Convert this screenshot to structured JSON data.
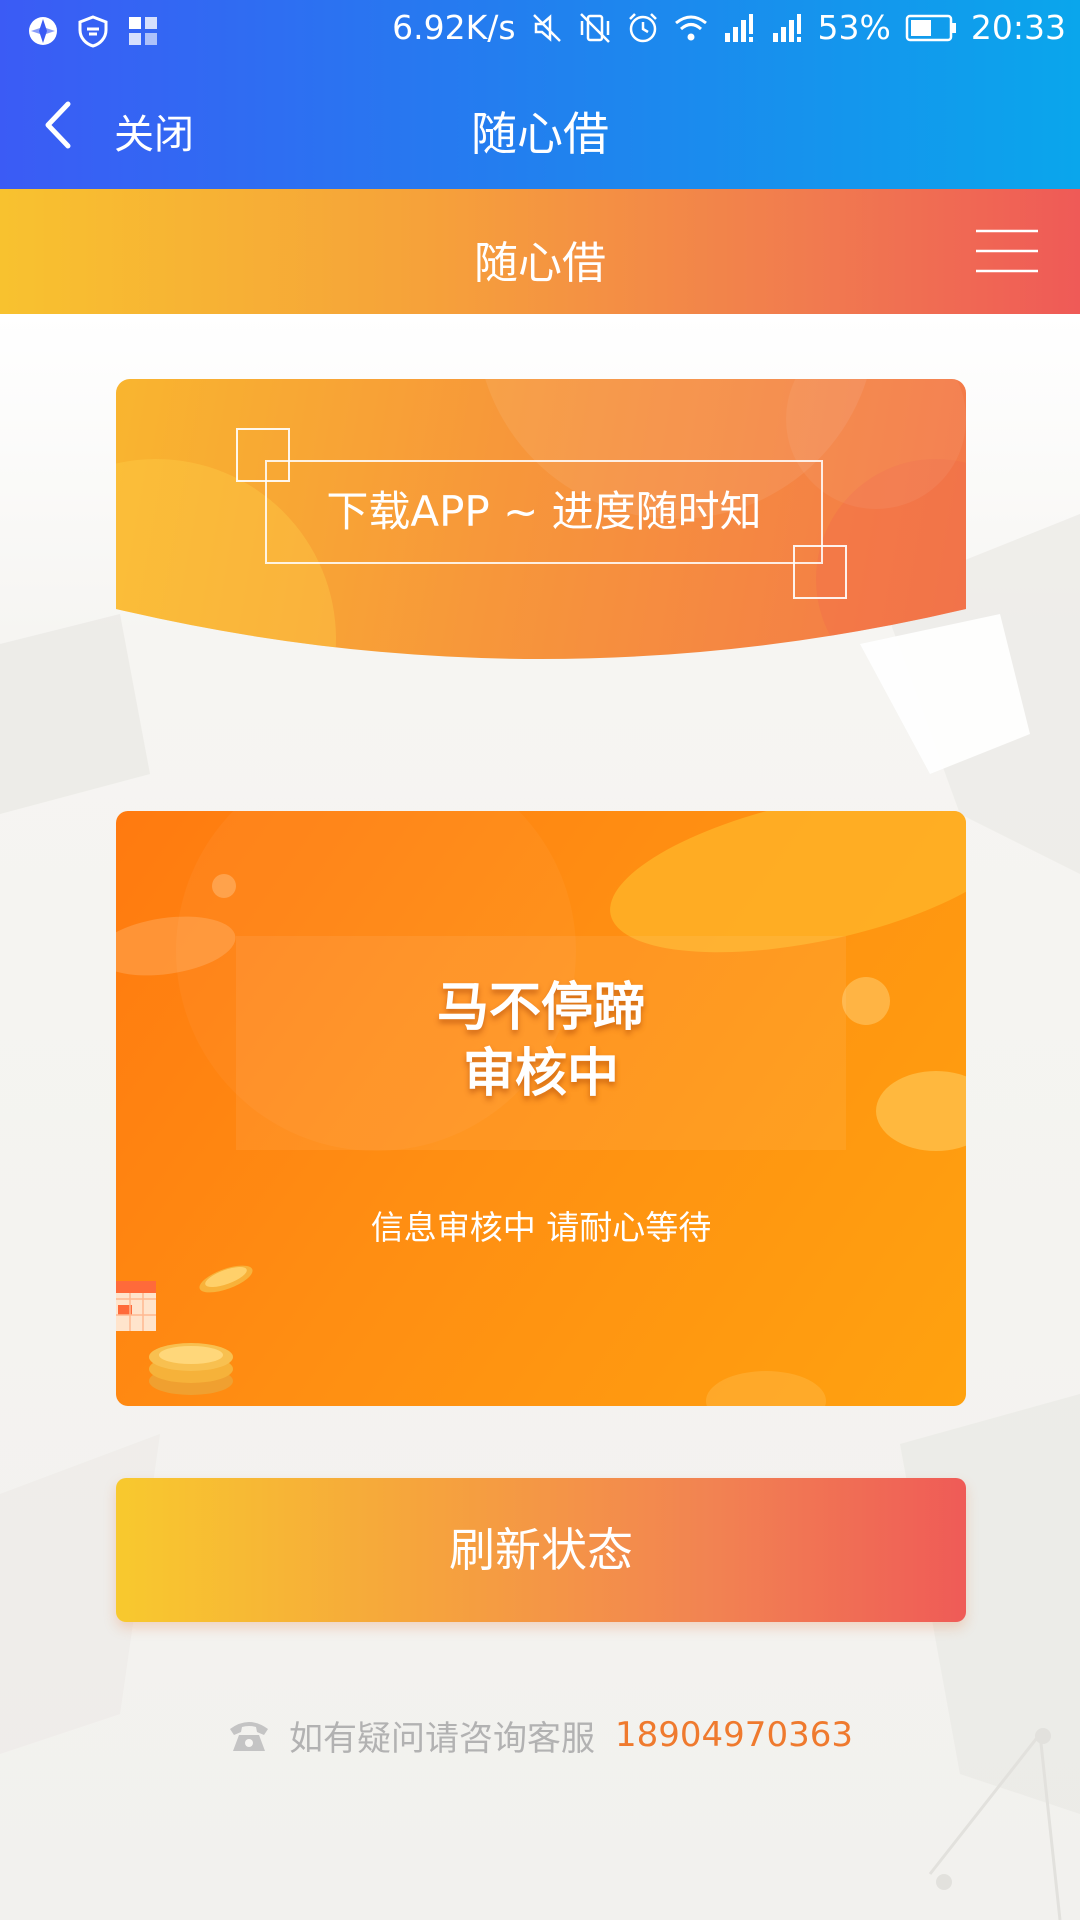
{
  "status_bar": {
    "network_speed": "6.92K/s",
    "battery_percent": "53%",
    "time": "20:33",
    "icons": [
      "app-icon",
      "shield-icon",
      "grid-icon",
      "mute-icon",
      "vibrate-off-icon",
      "alarm-icon",
      "wifi-icon",
      "signal-icon",
      "signal-icon",
      "battery-icon"
    ]
  },
  "app_bar": {
    "close_label": "关闭",
    "title": "随心借"
  },
  "sub_header": {
    "title": "随心借"
  },
  "banner": {
    "text": "下载APP ~ 进度随时知"
  },
  "status_card": {
    "title_line1": "马不停蹄",
    "title_line2": "审核中",
    "subtitle": "信息审核中 请耐心等待"
  },
  "refresh_button": {
    "label": "刷新状态"
  },
  "footer": {
    "help_text": "如有疑问请咨询客服",
    "phone_number": "18904970363"
  },
  "colors": {
    "top_bar_start": "#3b5bf5",
    "top_bar_end": "#0aa6ec",
    "orange_gradient_start": "#f8c22f",
    "orange_gradient_end": "#ef5a57",
    "card_orange": "#ff8a12",
    "phone_number": "#ef7a2e"
  }
}
